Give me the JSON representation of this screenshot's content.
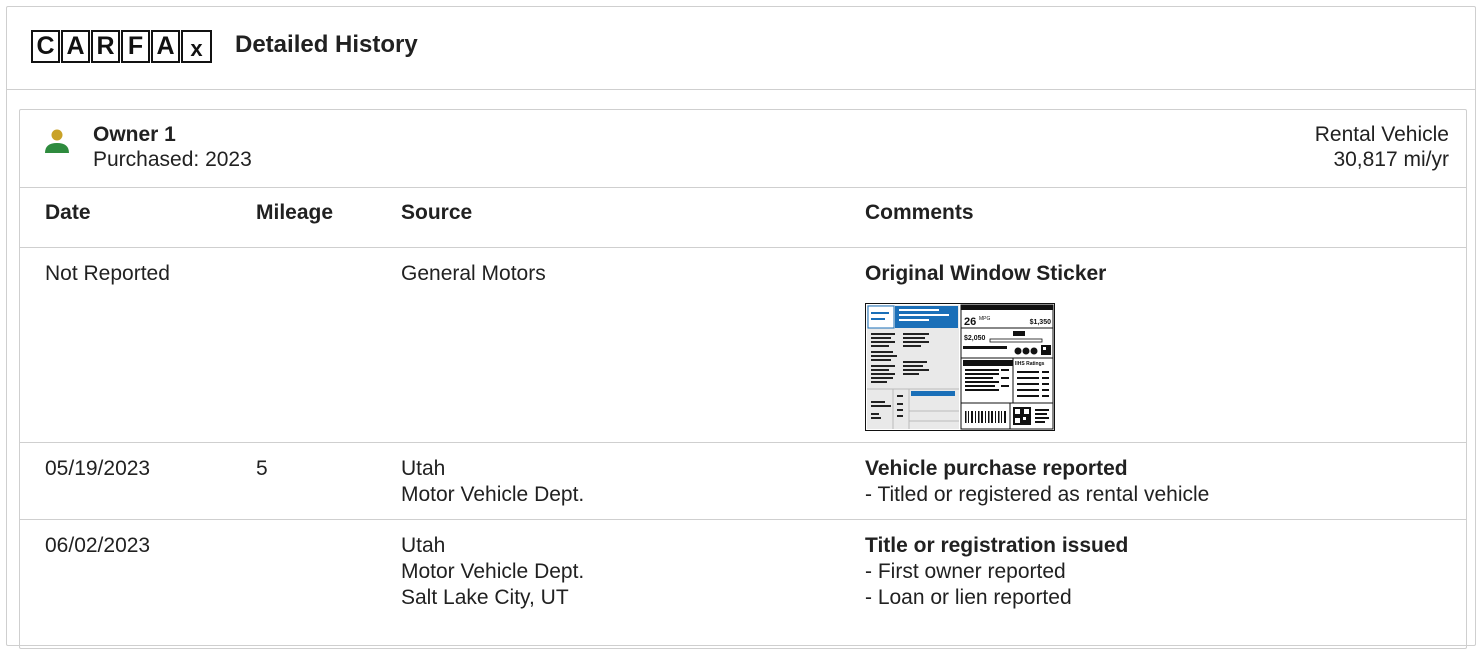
{
  "header": {
    "logo_letters": [
      "C",
      "A",
      "R",
      "F",
      "A",
      "x"
    ],
    "title": "Detailed History"
  },
  "owner": {
    "name": "Owner 1",
    "purchased": "Purchased: 2023",
    "type": "Rental Vehicle",
    "miles": "30,817 mi/yr"
  },
  "table": {
    "headers": [
      "Date",
      "Mileage",
      "Source",
      "Comments"
    ],
    "rows": [
      {
        "date": "Not Reported",
        "mileage": "",
        "source": [
          "General Motors"
        ],
        "comment_title": "Original Window Sticker",
        "comment_items": []
      },
      {
        "date": "05/19/2023",
        "mileage": "5",
        "source": [
          "Utah",
          "Motor Vehicle Dept."
        ],
        "comment_title": "Vehicle purchase reported",
        "comment_items": [
          "- Titled or registered as rental vehicle"
        ]
      },
      {
        "date": "06/02/2023",
        "mileage": "",
        "source": [
          "Utah",
          "Motor Vehicle Dept.",
          "Salt Lake City, UT"
        ],
        "comment_title": "Title or registration issued",
        "comment_items": [
          "- First owner reported",
          "- Loan or lien reported"
        ]
      }
    ]
  },
  "sticker": {
    "mpg": "26",
    "mpg_unit": "MPG",
    "save_value": "$1,350",
    "fuel_cost": "$2,050",
    "ratings_label": "IIHS Ratings"
  },
  "colors": {
    "owner_icon_head": "#c9a227",
    "owner_icon_body": "#2e8b3e",
    "border": "#cfcfcf",
    "sticker_blue": "#1a6fb8"
  }
}
